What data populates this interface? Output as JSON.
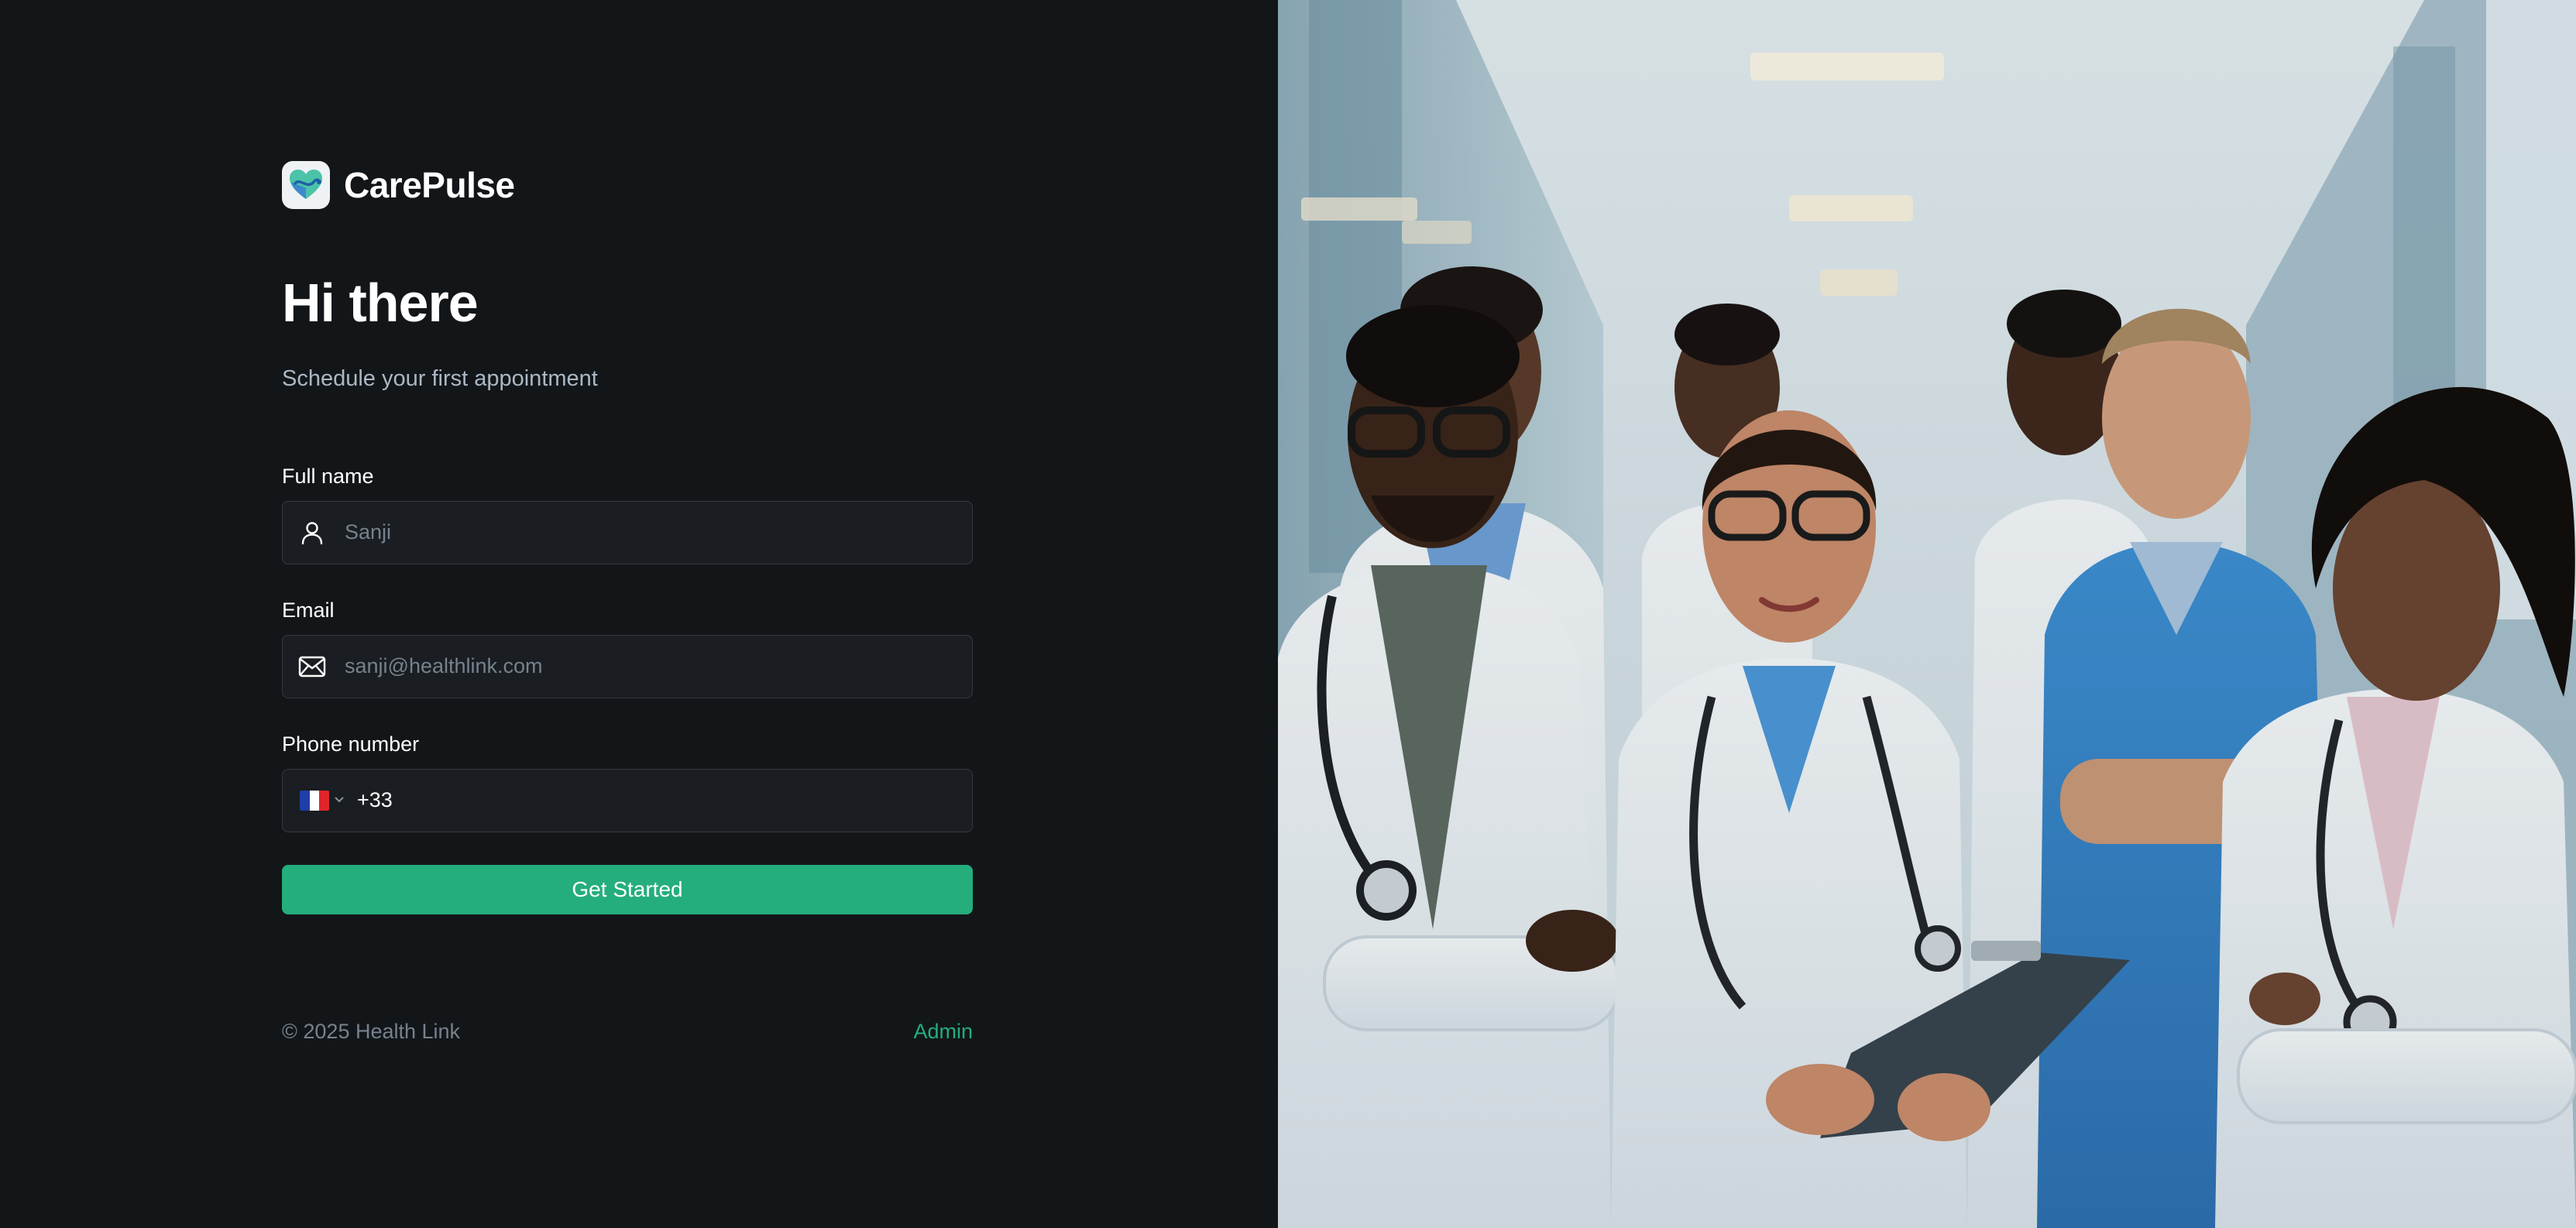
{
  "brand": {
    "name": "CarePulse",
    "logo_icon": "heart-stethoscope-logo-icon",
    "accent": "#24ae7c"
  },
  "intro": {
    "title": "Hi there",
    "subtitle": "Schedule your first appointment"
  },
  "form": {
    "full_name": {
      "label": "Full name",
      "placeholder": "Sanji",
      "icon": "user-icon"
    },
    "email": {
      "label": "Email",
      "placeholder": "sanji@healthlink.com",
      "icon": "mail-icon"
    },
    "phone": {
      "label": "Phone number",
      "value": "+33",
      "country_flag": "france-flag-icon"
    },
    "submit_label": "Get Started"
  },
  "footer": {
    "copyright": "© 2025 Health Link",
    "admin_label": "Admin"
  },
  "hero_image": {
    "subject": "doctors-group-photo"
  },
  "colors": {
    "background": "#131619",
    "input_bg": "#1a1d21",
    "input_border": "#363a3d",
    "muted_text": "#76828d",
    "button": "#24ae7c"
  }
}
